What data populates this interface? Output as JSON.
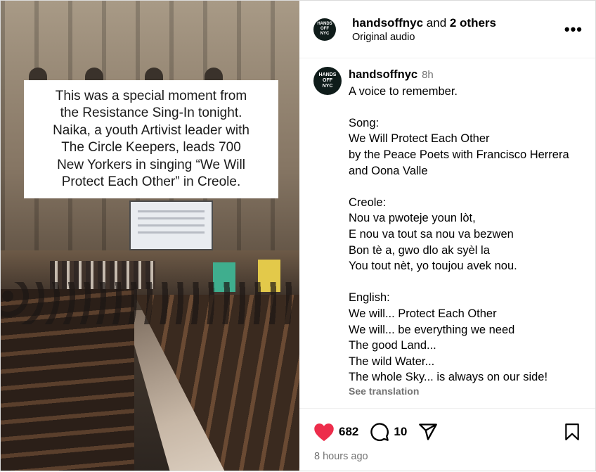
{
  "media": {
    "caption": "This was a special moment from\nthe Resistance Sing-In tonight.\nNaika, a youth Artivist leader with\nThe Circle Keepers, leads 700\nNew Yorkers in singing “We Will\nProtect Each Other” in Creole."
  },
  "header": {
    "username": "handsoffnyc",
    "and_text": " and ",
    "others": "2 others",
    "audio": "Original audio",
    "avatar_lines": [
      "HANDS",
      "OFF",
      "NYC"
    ]
  },
  "comment": {
    "username": "handsoffnyc",
    "time": "8h",
    "text": "A voice to remember.\n\nSong:\nWe Will Protect Each Other\nby the Peace Poets with Francisco Herrera\nand Oona Valle\n\nCreole:\nNou va pwoteje youn lòt,\nE nou va tout sa nou va bezwen\nBon tè a, gwo dlo ak syèl la\nYou tout nèt, yo toujou avek nou.\n\nEnglish:\nWe will... Protect Each Other\nWe will... be everything we need\nThe good Land...\nThe wild Water...\nThe whole Sky... is always on our side!",
    "see_translation": "See translation"
  },
  "actions": {
    "likes": "682",
    "comments": "10",
    "timestamp": "8 hours ago"
  },
  "colors": {
    "like": "#ed2d4b",
    "muted": "#737373"
  },
  "icons": [
    "heart-icon",
    "comment-icon",
    "share-icon",
    "bookmark-icon",
    "more-icon"
  ]
}
